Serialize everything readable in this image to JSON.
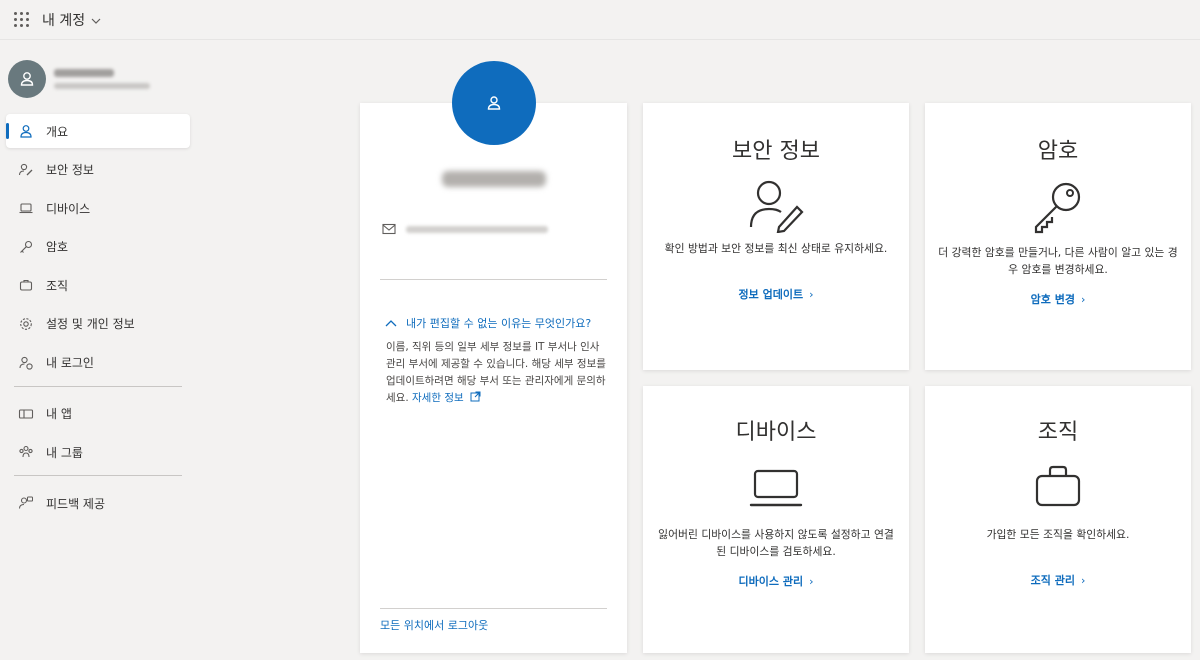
{
  "header": {
    "app_title": "내 계정",
    "waffle_icon": "waffle-icon",
    "chevron_icon": "chevron-down-icon"
  },
  "sidebar": {
    "items": [
      {
        "label": "개요",
        "icon": "person-icon",
        "active": true
      },
      {
        "label": "보안 정보",
        "icon": "person-key-icon"
      },
      {
        "label": "디바이스",
        "icon": "laptop-icon"
      },
      {
        "label": "암호",
        "icon": "key-icon"
      },
      {
        "label": "조직",
        "icon": "briefcase-icon"
      },
      {
        "label": "설정 및 개인 정보",
        "icon": "gear-icon"
      },
      {
        "label": "내 로그인",
        "icon": "person-refresh-icon"
      },
      {
        "label": "내 앱",
        "icon": "apps-icon"
      },
      {
        "label": "내 그룹",
        "icon": "group-icon"
      },
      {
        "label": "피드백 제공",
        "icon": "feedback-icon"
      }
    ]
  },
  "profile": {
    "why_question": "내가 편집할 수 없는 이유는 무엇인가요?",
    "why_body": "이름, 직위 등의 일부 세부 정보를 IT 부서나 인사 관리 부서에 제공할 수 있습니다. 해당 세부 정보를 업데이트하려면 해당 부서 또는 관리자에게 문의하세요.",
    "learn_more": "자세한 정보",
    "sign_out_everywhere": "모든 위치에서 로그아웃"
  },
  "tiles": {
    "security": {
      "title": "보안 정보",
      "desc": "확인 방법과 보안 정보를 최신 상태로 유지하세요.",
      "link": "정보 업데이트"
    },
    "password": {
      "title": "암호",
      "desc": "더 강력한 암호를 만들거나, 다른 사람이 알고 있는 경우 암호를 변경하세요.",
      "link": "암호 변경"
    },
    "devices": {
      "title": "디바이스",
      "desc": "잃어버린 디바이스를 사용하지 않도록 설정하고 연결된 디바이스를 검토하세요.",
      "link": "디바이스 관리"
    },
    "organizations": {
      "title": "조직",
      "desc": "가입한 모든 조직을 확인하세요.",
      "link": "조직 관리"
    }
  },
  "colors": {
    "accent": "#0f6cbd",
    "avatar_gray": "#69797e",
    "background": "#f3f2f1"
  }
}
